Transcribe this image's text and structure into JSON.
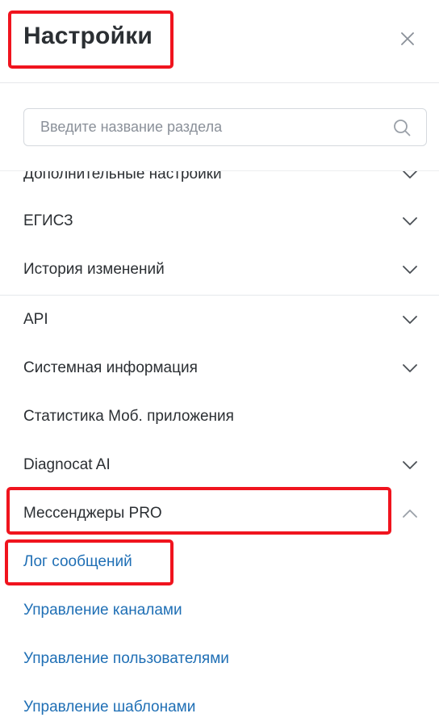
{
  "header": {
    "title": "Настройки"
  },
  "search": {
    "placeholder": "Введите название раздела",
    "value": ""
  },
  "sections": [
    {
      "label": "Дополнительные настройки",
      "expandable": true,
      "expanded": false
    },
    {
      "label": "ЕГИСЗ",
      "expandable": true,
      "expanded": false
    },
    {
      "label": "История изменений",
      "expandable": true,
      "expanded": false
    },
    {
      "label": "API",
      "expandable": true,
      "expanded": false
    },
    {
      "label": "Системная информация",
      "expandable": true,
      "expanded": false
    },
    {
      "label": "Статистика Моб. приложения",
      "expandable": false,
      "expanded": false
    },
    {
      "label": "Diagnocat AI",
      "expandable": true,
      "expanded": false
    },
    {
      "label": "Мессенджеры PRO",
      "expandable": true,
      "expanded": true
    }
  ],
  "submenu": [
    {
      "label": "Лог сообщений"
    },
    {
      "label": "Управление каналами"
    },
    {
      "label": "Управление пользователями"
    },
    {
      "label": "Управление шаблонами"
    }
  ],
  "colors": {
    "link": "#1f6fb5",
    "highlight": "#f0141e",
    "text": "#2b2f33"
  },
  "icons": {
    "close": "close-icon",
    "search": "search-icon",
    "chevron_down": "chevron-down-icon",
    "chevron_up": "chevron-up-icon"
  }
}
